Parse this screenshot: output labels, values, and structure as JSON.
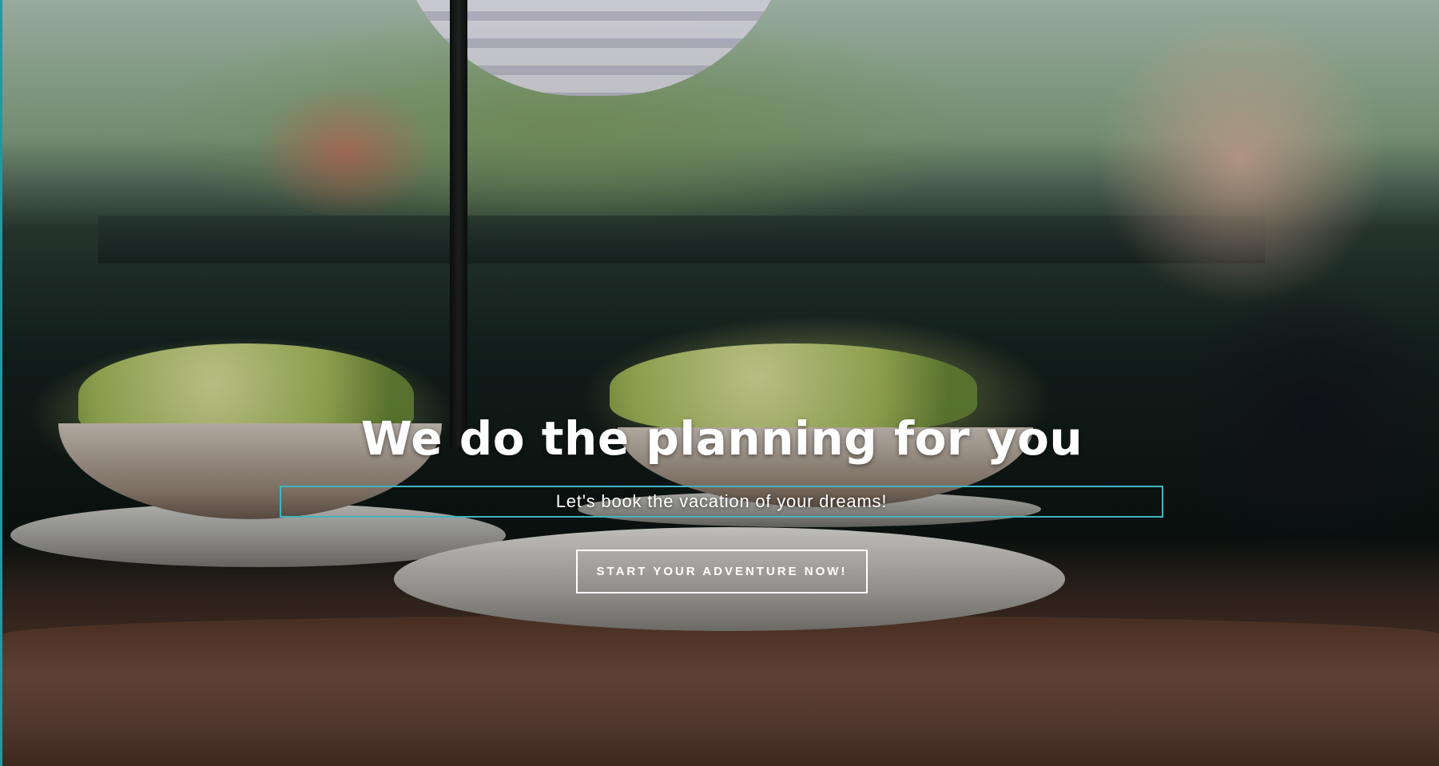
{
  "hero": {
    "headline": "We do the planning for you",
    "subheadline": "Let's book the vacation of your dreams!",
    "cta_label": "START YOUR ADVENTURE NOW!"
  },
  "colors": {
    "accent_border": "#3fb6c2",
    "text": "#ffffff"
  }
}
